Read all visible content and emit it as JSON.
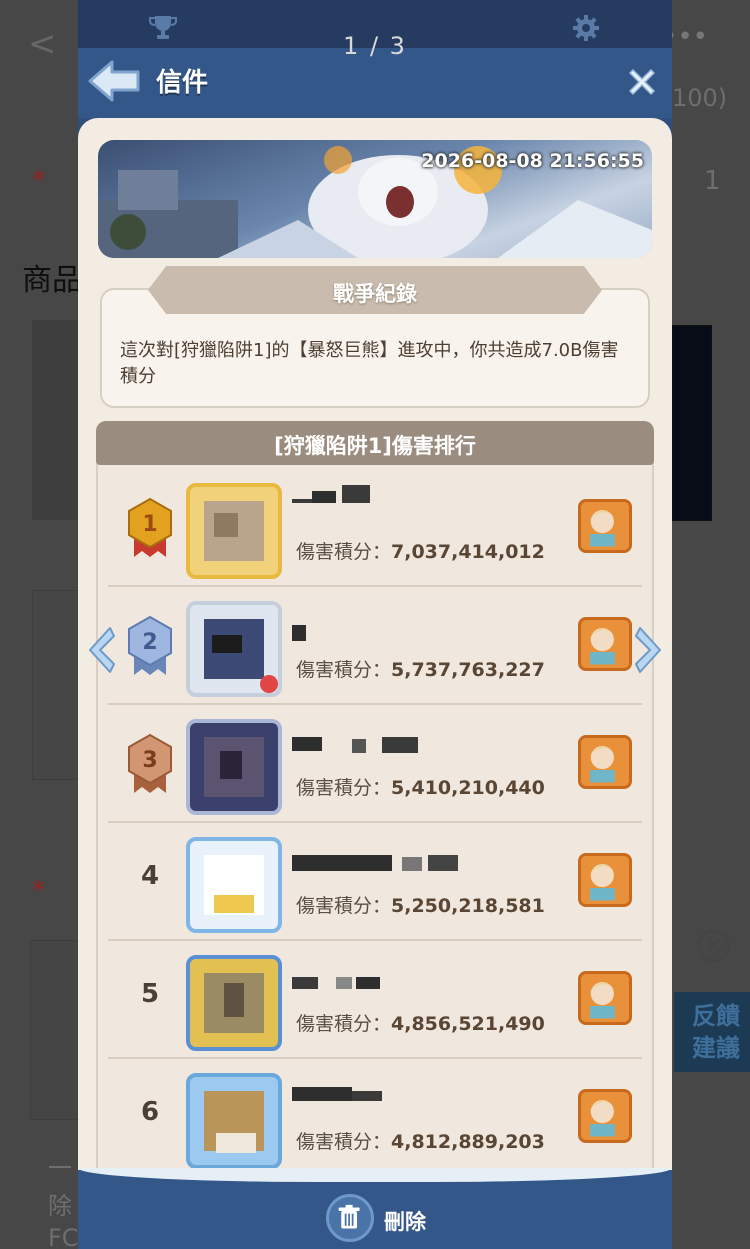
{
  "overlay": {
    "counter": "1 / 3",
    "back_glyph": "<",
    "more_glyph": "•••",
    "fragments": {
      "f_100": "100)",
      "f_1": "1",
      "f_goods": "商品",
      "f_feedback": "反饋\n建議",
      "f_line1": "一",
      "f_line2": "除",
      "f_line3": "FC"
    }
  },
  "game": {
    "header": {
      "title": "信件"
    },
    "mail": {
      "timestamp": "2026-08-08 21:56:55",
      "record_title": "戰爭紀錄",
      "record_text": "這次對[狩獵陷阱1]的【暴怒巨熊】進攻中，你共造成7.0B傷害積分"
    },
    "ranking": {
      "title": "[狩獵陷阱1]傷害排行",
      "score_label": "傷害積分：",
      "rows": [
        {
          "rank": "1",
          "score": "7,037,414,012"
        },
        {
          "rank": "2",
          "score": "5,737,763,227"
        },
        {
          "rank": "3",
          "score": "5,410,210,440"
        },
        {
          "rank": "4",
          "score": "5,250,218,581"
        },
        {
          "rank": "5",
          "score": "4,856,521,490"
        },
        {
          "rank": "6",
          "score": "4,812,889,203"
        }
      ]
    },
    "footer": {
      "delete_label": "刪除"
    },
    "colors": {
      "panel_blue": "#34578a",
      "card_bg": "#f3ece3",
      "gold_medal": "#e2a21f",
      "silver_medal": "#8fa9d6",
      "bronze_medal": "#c7855d"
    }
  }
}
